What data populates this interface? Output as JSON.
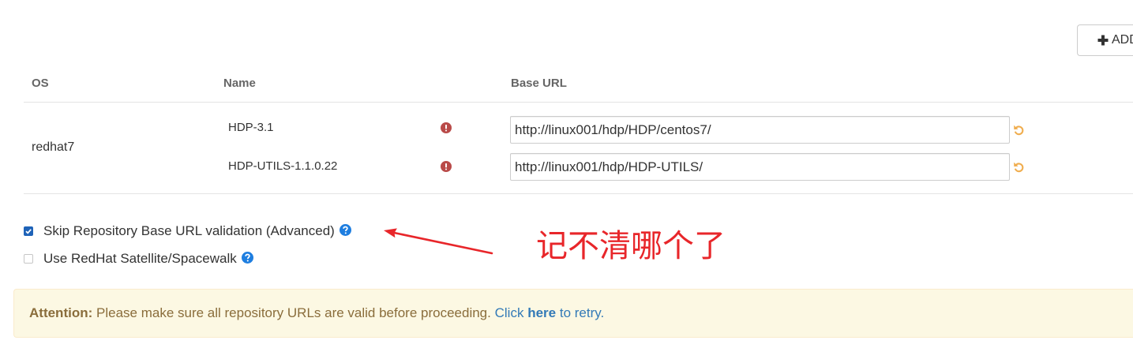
{
  "colors": {
    "text": "#333333",
    "header_text": "#666666",
    "divider": "#e4e4e4",
    "input_border": "#cccccc",
    "error_icon": "#b94a48",
    "undo_icon": "#f0ad4e",
    "help_icon": "#1e7ee0",
    "checkbox_checked": "#1f63b8",
    "annotation": "#e8262a",
    "alert_bg": "#fcf8e3",
    "alert_border": "#faebcc",
    "alert_text": "#8a6d3b",
    "link": "#337ab7"
  },
  "toolbar": {
    "add_button": {
      "icon": "plus-icon",
      "label": "ADD"
    }
  },
  "table": {
    "headers": {
      "os": "OS",
      "name": "Name",
      "base_url": "Base URL"
    },
    "os_groups": [
      {
        "os": "redhat7",
        "repos": [
          {
            "name": "HDP-3.1",
            "status_icon": "exclamation-circle-icon",
            "base_url": "http://linux001/hdp/HDP/centos7/",
            "action_icon": "undo-icon"
          },
          {
            "name": "HDP-UTILS-1.1.0.22",
            "status_icon": "exclamation-circle-icon",
            "base_url": "http://linux001/hdp/HDP-UTILS/",
            "action_icon": "undo-icon"
          }
        ]
      }
    ]
  },
  "options": [
    {
      "label": "Skip Repository Base URL validation (Advanced)",
      "checked": true,
      "help_icon": "question-circle-icon"
    },
    {
      "label": "Use RedHat Satellite/Spacewalk",
      "checked": false,
      "help_icon": "question-circle-icon"
    }
  ],
  "annotation": {
    "text": "记不清哪个了",
    "arrow_icon": "arrow-icon"
  },
  "alert": {
    "title": "Attention:",
    "message": "Please make sure all repository URLs are valid before proceeding.",
    "retry_prefix": "Click",
    "retry_link": "here",
    "retry_suffix": "to retry."
  }
}
